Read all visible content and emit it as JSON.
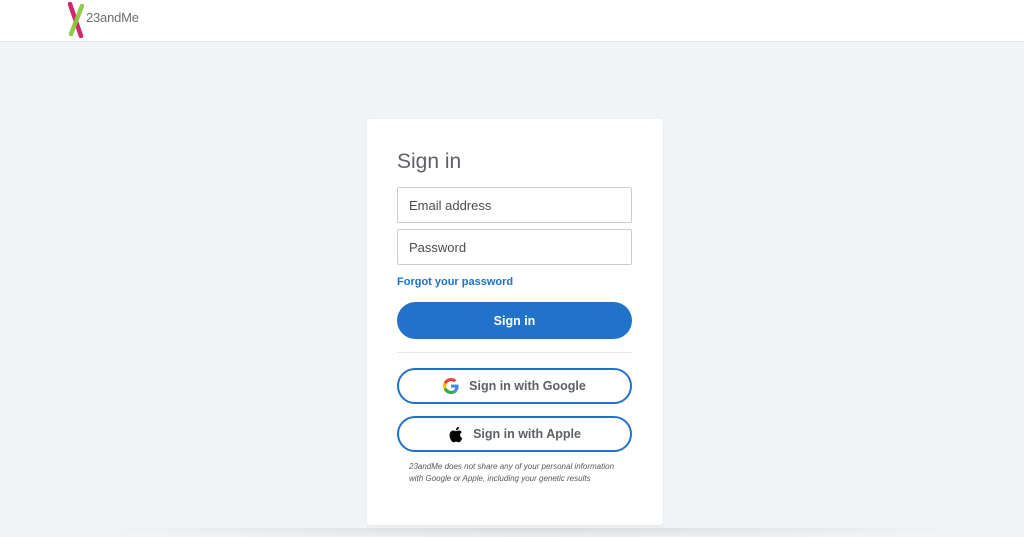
{
  "header": {
    "brand_name": "23andMe"
  },
  "signin": {
    "title": "Sign in",
    "email_placeholder": "Email address",
    "email_value": "",
    "password_placeholder": "Password",
    "password_value": "",
    "forgot_label": "Forgot your password",
    "submit_label": "Sign in",
    "google_label": "Sign in with Google",
    "apple_label": "Sign in with Apple",
    "disclaimer": "23andMe does not share any of your personal information with Google or Apple,  including your genetic results"
  },
  "colors": {
    "accent": "#2173c9",
    "link": "#1a73c7",
    "background": "#f1f4f7",
    "logo_green": "#8cc63f",
    "logo_pink": "#d6246e"
  },
  "icons": {
    "brand": "23andme-logo-icon",
    "google": "google-icon",
    "apple": "apple-icon"
  }
}
